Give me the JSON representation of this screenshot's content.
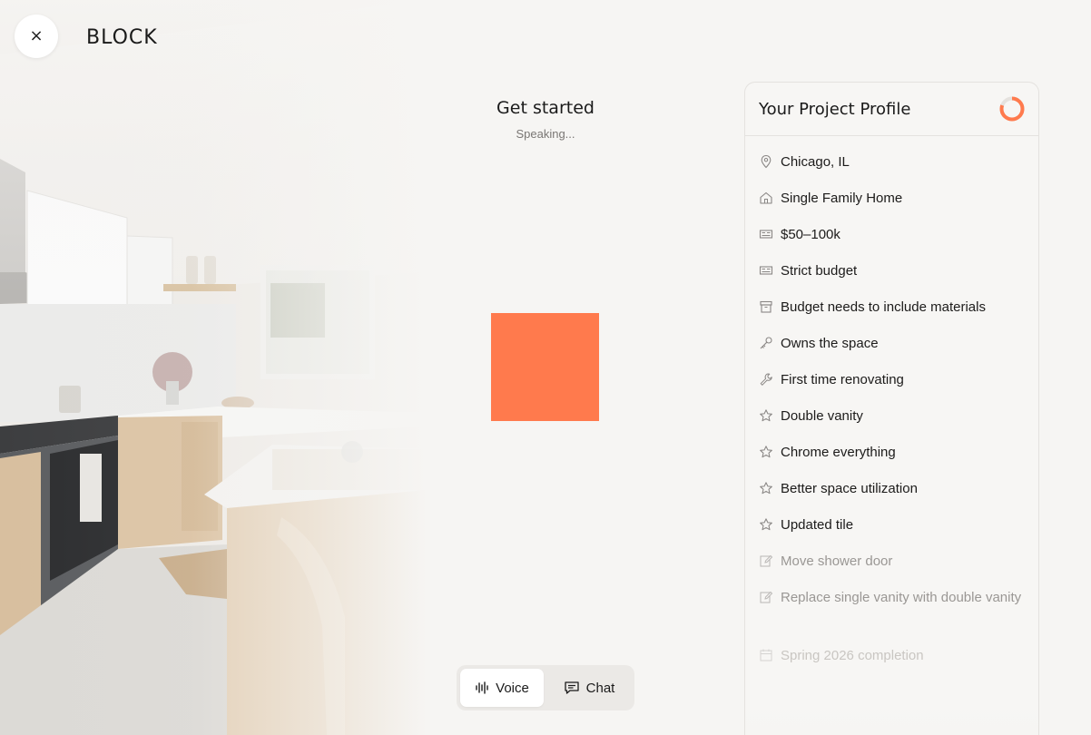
{
  "header": {
    "close_label": "×",
    "brand": "BLOCK"
  },
  "session": {
    "title": "Get started",
    "status": "Speaking...",
    "orb_color": "#ff7a4d"
  },
  "modes": [
    {
      "label": "Voice",
      "icon": "waveform-icon",
      "active": true
    },
    {
      "label": "Chat",
      "icon": "chat-bubble-icon",
      "active": false
    }
  ],
  "profile": {
    "title": "Your Project Profile",
    "accent_color": "#ff7a4d",
    "completion_fraction": 0.8,
    "items": [
      {
        "label": "Chicago, IL",
        "icon": "location-pin-icon"
      },
      {
        "label": "Single Family Home",
        "icon": "house-icon"
      },
      {
        "label": "$50–100k",
        "icon": "banknote-icon"
      },
      {
        "label": "Strict budget",
        "icon": "banknote-icon"
      },
      {
        "label": "Budget needs to include materials",
        "icon": "archive-box-icon"
      },
      {
        "label": "Owns the space",
        "icon": "key-icon"
      },
      {
        "label": "First time renovating",
        "icon": "wrench-icon"
      },
      {
        "label": "Double vanity",
        "icon": "star-icon"
      },
      {
        "label": "Chrome everything",
        "icon": "star-icon"
      },
      {
        "label": "Better space utilization",
        "icon": "star-icon"
      },
      {
        "label": "Updated tile",
        "icon": "star-icon"
      },
      {
        "label": "Move shower door",
        "icon": "edit-icon"
      },
      {
        "label": "Replace single vanity with double vanity",
        "icon": "edit-icon"
      },
      {
        "label": "Spring 2026 completion",
        "icon": "calendar-icon"
      }
    ]
  }
}
